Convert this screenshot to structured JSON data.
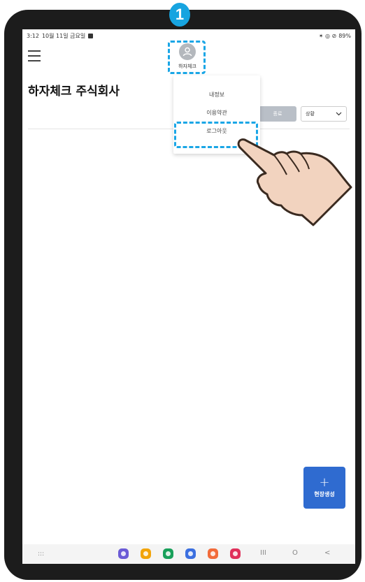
{
  "status_bar": {
    "time": "3:12",
    "date": "10월 11일 금요일",
    "right_icons": "✶ ◎ ⊘",
    "battery": "89%"
  },
  "profile": {
    "name": "하자체크",
    "icon": "user-icon"
  },
  "company": {
    "title": "하자체크 주식회사"
  },
  "controls": {
    "filter_label": "종료",
    "sort_value": "상황"
  },
  "menu": {
    "items": [
      {
        "label": "내정보"
      },
      {
        "label": "이용약관"
      },
      {
        "label": "로그아웃"
      }
    ]
  },
  "fab": {
    "plus": "+",
    "label": "현장생성"
  },
  "annotation": {
    "step": "1"
  },
  "navbar": {
    "apps": ":::",
    "recent": "III",
    "home": "O",
    "back": "<",
    "dock_colors": [
      "#6b5bd6",
      "#f2a40a",
      "#18a05a",
      "#3b6fe0",
      "#f26b3a",
      "#e0305a"
    ]
  },
  "colors": {
    "accent": "#2f6bd0",
    "highlight": "#1aa6e6"
  }
}
